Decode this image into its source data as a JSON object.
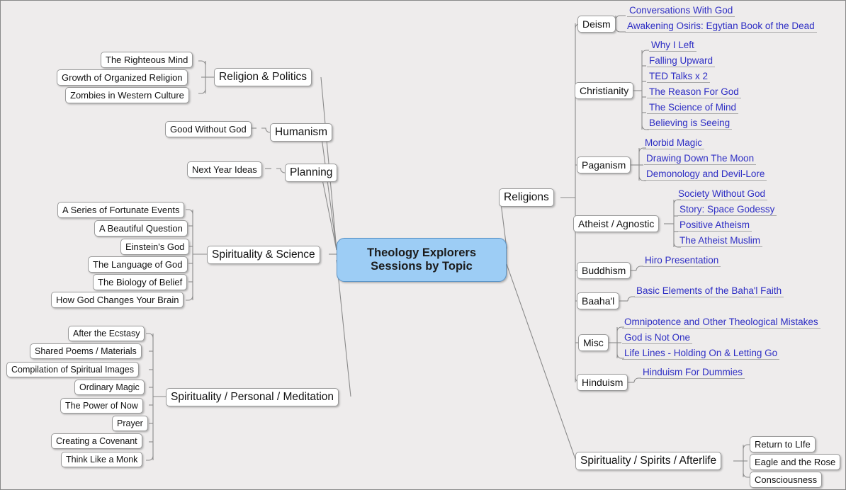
{
  "diagram": {
    "title": "Theology Explorers Sessions by Topic",
    "type": "mind-map",
    "colors": {
      "background": "#eeecec",
      "root_fill": "#9dcdf5",
      "root_border": "#5a94c8",
      "node_fill": "#ffffff",
      "node_border": "#9a9a9a",
      "link_text": "#2e2ec4",
      "connector": "#8a8a8a"
    }
  },
  "root": {
    "label": "Theology Explorers\nSessions by Topic",
    "line1": "Theology Explorers",
    "line2": "Sessions by Topic"
  },
  "left_branches": [
    {
      "label": "Religion & Politics",
      "children": [
        {
          "label": "The Righteous Mind"
        },
        {
          "label": "Growth of Organized Religion"
        },
        {
          "label": "Zombies in Western Culture"
        }
      ]
    },
    {
      "label": "Humanism",
      "children": [
        {
          "label": "Good Without God"
        }
      ]
    },
    {
      "label": "Planning",
      "children": [
        {
          "label": "Next Year Ideas"
        }
      ]
    },
    {
      "label": "Spirituality & Science",
      "children": [
        {
          "label": "A Series of Fortunate Events"
        },
        {
          "label": "A Beautiful Question"
        },
        {
          "label": "Einstein's God"
        },
        {
          "label": "The Language of God"
        },
        {
          "label": "The Biology of Belief"
        },
        {
          "label": "How God Changes Your Brain"
        }
      ]
    },
    {
      "label": "Spirituality / Personal / Meditation",
      "children": [
        {
          "label": "After the Ecstasy"
        },
        {
          "label": "Shared Poems / Materials"
        },
        {
          "label": "Compilation of Spiritual Images"
        },
        {
          "label": "Ordinary Magic"
        },
        {
          "label": "The Power of Now"
        },
        {
          "label": "Prayer"
        },
        {
          "label": "Creating a Covenant"
        },
        {
          "label": "Think Like a Monk"
        }
      ]
    }
  ],
  "right_branches": [
    {
      "label": "Religions",
      "children": [
        {
          "label": "Deism",
          "items": [
            {
              "label": "Conversations With God"
            },
            {
              "label": "Awakening Osiris: Egytian Book of the Dead"
            }
          ]
        },
        {
          "label": "Christianity",
          "items": [
            {
              "label": "Why I Left"
            },
            {
              "label": "Falling Upward"
            },
            {
              "label": "TED Talks x 2"
            },
            {
              "label": "The Reason For God"
            },
            {
              "label": "The Science of Mind"
            },
            {
              "label": "Believing is Seeing"
            }
          ]
        },
        {
          "label": "Paganism",
          "items": [
            {
              "label": "Morbid Magic"
            },
            {
              "label": "Drawing Down The Moon"
            },
            {
              "label": "Demonology and Devil-Lore"
            }
          ]
        },
        {
          "label": "Atheist / Agnostic",
          "items": [
            {
              "label": "Society Without God"
            },
            {
              "label": "Story: Space Godessy"
            },
            {
              "label": "Positive Atheism"
            },
            {
              "label": "The Atheist Muslim"
            }
          ]
        },
        {
          "label": "Buddhism",
          "items": [
            {
              "label": "Hiro Presentation"
            }
          ]
        },
        {
          "label": "Baaha'l",
          "items": [
            {
              "label": "Basic Elements of the Baha'l Faith"
            }
          ]
        },
        {
          "label": "Misc",
          "items": [
            {
              "label": "Omnipotence and Other Theological Mistakes"
            },
            {
              "label": "God is Not One"
            },
            {
              "label": "Life Lines - Holding On & Letting Go"
            }
          ]
        },
        {
          "label": "Hinduism",
          "items": [
            {
              "label": "Hinduism For Dummies"
            }
          ]
        }
      ]
    },
    {
      "label": "Spirituality / Spirits / Afterlife",
      "children": [],
      "items": [
        {
          "label": "Return to LIfe"
        },
        {
          "label": "Eagle and the Rose"
        },
        {
          "label": "Consciousness"
        }
      ]
    }
  ]
}
